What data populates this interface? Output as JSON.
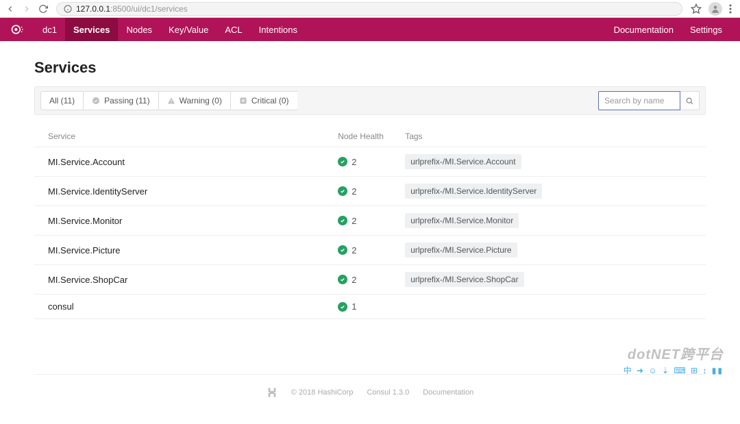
{
  "browser": {
    "url_host": "127.0.0.1",
    "url_port_path": ":8500/ui/dc1/services"
  },
  "nav": {
    "dc": "dc1",
    "items": [
      "Services",
      "Nodes",
      "Key/Value",
      "ACL",
      "Intentions"
    ],
    "doc": "Documentation",
    "settings": "Settings"
  },
  "page": {
    "title": "Services"
  },
  "filters": {
    "all": "All (11)",
    "passing": "Passing (11)",
    "warning": "Warning (0)",
    "critical": "Critical (0)",
    "search_placeholder": "Search by name"
  },
  "columns": {
    "service": "Service",
    "node_health": "Node Health",
    "tags": "Tags"
  },
  "services": [
    {
      "name": "MI.Service.Account",
      "health": "2",
      "tag": "urlprefix-/MI.Service.Account"
    },
    {
      "name": "MI.Service.IdentityServer",
      "health": "2",
      "tag": "urlprefix-/MI.Service.IdentityServer"
    },
    {
      "name": "MI.Service.Monitor",
      "health": "2",
      "tag": "urlprefix-/MI.Service.Monitor"
    },
    {
      "name": "MI.Service.Picture",
      "health": "2",
      "tag": "urlprefix-/MI.Service.Picture"
    },
    {
      "name": "MI.Service.ShopCar",
      "health": "2",
      "tag": "urlprefix-/MI.Service.ShopCar"
    },
    {
      "name": "consul",
      "health": "1",
      "tag": ""
    }
  ],
  "footer": {
    "copyright": "© 2018 HashiCorp",
    "version": "Consul 1.3.0",
    "doc": "Documentation"
  },
  "watermark": {
    "text": "dotNET跨平台",
    "icons": "中 ➜ ☺ ⇣ ⌨ ⊞ ↕ ▮▮"
  }
}
